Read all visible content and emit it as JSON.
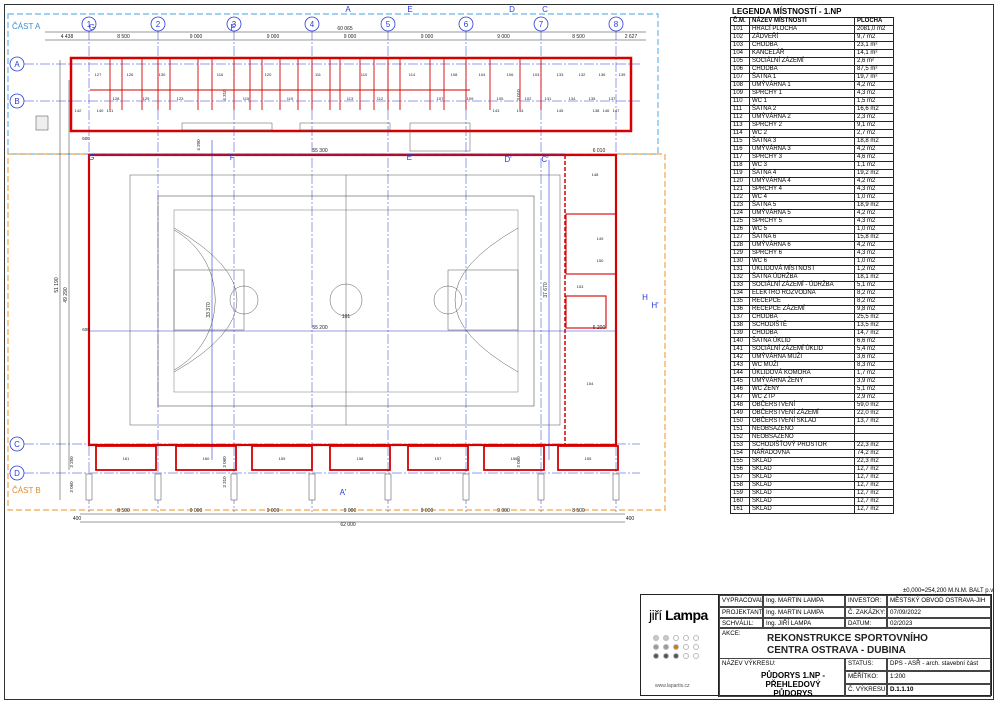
{
  "legend": {
    "title": "LEGENDA MÍSTNOSTÍ - 1.NP",
    "headers": [
      "Č.M.",
      "NÁZEV MÍSTNOSTI",
      "PLOCHA"
    ],
    "rows": [
      [
        "101",
        "HRACÍ PLOCHA",
        "2081,0 m2"
      ],
      [
        "102",
        "ZÁDVEŘÍ",
        "9,7 m2"
      ],
      [
        "103",
        "CHODBA",
        "23,1 m²"
      ],
      [
        "104",
        "KANCELÁŘ",
        "14,1 m²"
      ],
      [
        "105",
        "SOCIÁLNÍ ZÁZEMÍ",
        "2,6 m²"
      ],
      [
        "106",
        "CHODBA",
        "87,5 m²"
      ],
      [
        "107",
        "ŠATNA 1",
        "19,7 m²"
      ],
      [
        "108",
        "UMÝVÁRNA 1",
        "4,2 m2"
      ],
      [
        "109",
        "SPRCHY 1",
        "4,3 m2"
      ],
      [
        "110",
        "WC 1",
        "1,5 m2"
      ],
      [
        "111",
        "ŠATNA 2",
        "16,6 m2"
      ],
      [
        "112",
        "UMÝVÁRNA 2",
        "2,3 m2"
      ],
      [
        "113",
        "SPRCHY 2",
        "9,1 m2"
      ],
      [
        "114",
        "WC 2",
        "2,7 m2"
      ],
      [
        "115",
        "ŠATNA 3",
        "18,8 m2"
      ],
      [
        "116",
        "UMÝVÁRNA 3",
        "4,2 m2"
      ],
      [
        "117",
        "SPRCHY 3",
        "4,6 m2"
      ],
      [
        "118",
        "WC 3",
        "1,1 m2"
      ],
      [
        "119",
        "ŠATNA 4",
        "19,2 m2"
      ],
      [
        "120",
        "UMÝVÁRNA 4",
        "4,2 m2"
      ],
      [
        "121",
        "SPRCHY 4",
        "4,3 m2"
      ],
      [
        "122",
        "WC 4",
        "1,0 m2"
      ],
      [
        "123",
        "ŠATNA 5",
        "18,9 m2"
      ],
      [
        "124",
        "UMÝVÁRNA 5",
        "4,2 m2"
      ],
      [
        "125",
        "SPRCHY 5",
        "4,3 m2"
      ],
      [
        "126",
        "WC 5",
        "1,0 m2"
      ],
      [
        "127",
        "ŠATNA 6",
        "15,8 m2"
      ],
      [
        "128",
        "UMÝVÁRNA 6",
        "4,2 m2"
      ],
      [
        "129",
        "SPRCHY 6",
        "4,3 m2"
      ],
      [
        "130",
        "WC 6",
        "1,0 m2"
      ],
      [
        "131",
        "ÚKLIDOVÁ MÍSTNOST",
        "1,2 m2"
      ],
      [
        "132",
        "ŠATNA ÚDRŽBA",
        "18,1 m2"
      ],
      [
        "133",
        "SOCIÁLNÍ ZÁZEMÍ - ÚDRŽBA",
        "5,1 m2"
      ],
      [
        "134",
        "ELEKTRO ROZVODNA",
        "8,2 m2"
      ],
      [
        "135",
        "RECEPCE",
        "8,2 m2"
      ],
      [
        "136",
        "RECEPCE ZÁZEMÍ",
        "9,8 m2"
      ],
      [
        "137",
        "CHODBA",
        "25,5 m2"
      ],
      [
        "138",
        "SCHODIŠTĚ",
        "13,5 m2"
      ],
      [
        "139",
        "CHODBA",
        "14,7 m2"
      ],
      [
        "140",
        "ŠATNA ÚKLID",
        "6,6 m2"
      ],
      [
        "141",
        "SOCIÁLNÍ ZÁZEMÍ ÚKLID",
        "5,4 m2"
      ],
      [
        "142",
        "UMÝVÁRNA MUŽI",
        "3,6 m2"
      ],
      [
        "143",
        "WC MUŽI",
        "8,3 m2"
      ],
      [
        "144",
        "ÚKLIDOVÁ KOMORA",
        "1,7 m2"
      ],
      [
        "145",
        "UMÝVÁRNA ŽENY",
        "3,9 m2"
      ],
      [
        "146",
        "WC ŽENY",
        "5,1 m2"
      ],
      [
        "147",
        "WC ZTP",
        "2,9 m2"
      ],
      [
        "148",
        "OBČERSTVENÍ",
        "59,0 m2"
      ],
      [
        "149",
        "OBČERSTVENÍ ZÁZEMÍ",
        "22,0 m2"
      ],
      [
        "150",
        "OBČERSTVENÍ SKLAD",
        "13,7 m2"
      ],
      [
        "151",
        "NEOBSAZENO",
        ""
      ],
      [
        "152",
        "NEOBSAZENO",
        ""
      ],
      [
        "153",
        "SCHODIŠŤOVÝ PROSTOR",
        "22,3 m2"
      ],
      [
        "154",
        "NÁŘADOVNA",
        "74,2 m2"
      ],
      [
        "155",
        "SKLAD",
        "22,3 m2"
      ],
      [
        "156",
        "SKLAD",
        "12,7 m2"
      ],
      [
        "157",
        "SKLAD",
        "12,7 m2"
      ],
      [
        "158",
        "SKLAD",
        "12,7 m2"
      ],
      [
        "159",
        "SKLAD",
        "12,7 m2"
      ],
      [
        "160",
        "SKLAD",
        "12,7 m2"
      ],
      [
        "161",
        "SKLAD",
        "12,7 m2"
      ]
    ]
  },
  "plan": {
    "zone_a": "ČÁST A",
    "zone_b": "ČÁST B",
    "col_axes": [
      "1",
      "2",
      "3",
      "4",
      "5",
      "6",
      "7",
      "8"
    ],
    "row_axes": [
      "A",
      "B",
      "C",
      "D"
    ],
    "top_dims": [
      "4 438",
      "8 500",
      "9 000",
      "9 000",
      "9 000",
      "9 000",
      "9 000",
      "8 500",
      "2 627"
    ],
    "top_total": "60 065",
    "bottom_dims": [
      "8 500",
      "9 000",
      "9 000",
      "9 000",
      "9 000",
      "9 000",
      "8 500"
    ],
    "bottom_total": "62 000",
    "bottom_left": "400",
    "bottom_right": "400",
    "left_dims": [
      "51 190",
      "49 290"
    ],
    "mid_dims": [
      "55 300",
      "6 010",
      "55 200",
      "6 200",
      "33 370",
      "37 670"
    ],
    "small_dims": [
      "600",
      "600",
      "4 200",
      "3 250",
      "3 060",
      "3 310",
      "3 060",
      "4 310",
      "3 060",
      "3 010"
    ],
    "section_marks": [
      "A",
      "A'",
      "D",
      "D'",
      "E",
      "E'",
      "F",
      "F'",
      "G",
      "G'",
      "C",
      "C'",
      "H",
      "H'"
    ],
    "court_label": "101",
    "upper_rooms": [
      "127",
      "128",
      "126",
      "129",
      "130",
      "123",
      "116",
      "115",
      "120",
      "119",
      "111",
      "113",
      "110",
      "112",
      "114",
      "107",
      "108",
      "109",
      "104",
      "105",
      "106",
      "102",
      "103",
      "131",
      "133",
      "134",
      "132",
      "135",
      "136",
      "137",
      "139",
      "140",
      "141",
      "142",
      "143",
      "144",
      "145",
      "146",
      "147",
      "138"
    ],
    "right_rooms": [
      "148",
      "149",
      "150",
      "153",
      "154"
    ],
    "bottom_rooms": [
      "161",
      "160",
      "159",
      "158",
      "157",
      "156",
      "155"
    ]
  },
  "title_block": {
    "elevation": "±0,000=254,200 M.N.M. BALT p.v.",
    "logo_text_light": "jiří",
    "logo_text_bold": "Lampa",
    "logo_url": "www.lapartis.cz",
    "labels": {
      "drawn_by": "VYPRACOVAL:",
      "designer": "PROJEKTANT:",
      "approved": "SCHVÁLIL:",
      "investor": "INVESTOR:",
      "order_no": "Č. ZAKÁZKY:",
      "date": "DATUM:",
      "action": "AKCE:",
      "drawing_name": "NÁZEV VÝKRESU:",
      "status": "STATUS:",
      "scale": "MĚŘÍTKO:",
      "drawing_no": "Č. VÝKRESU:"
    },
    "values": {
      "drawn_by": "Ing. MARTIN LAMPA",
      "designer": "Ing. MARTIN LAMPA",
      "approved": "Ing. JIŘÍ LAMPA",
      "investor": "MĚSTSKÝ OBVOD OSTRAVA-JIH",
      "order_no": "07/09/2022",
      "date": "02/2023",
      "project": "REKONSTRUKCE SPORTOVNÍHO CENTRA OSTRAVA - DUBINA",
      "drawing_name": "PŮDORYS 1.NP - PŘEHLEDOVÝ PŮDORYS",
      "status": "DPS - ASŘ - arch. stavební část",
      "scale": "1:200",
      "drawing_no": "D.1.1.10"
    },
    "dot_colors": [
      "#c9c9c9",
      "#c9c9c9",
      "#ffffff",
      "#ffffff",
      "#ffffff",
      "#9a9a9a",
      "#9a9a9a",
      "#c97a1e",
      "#ffffff",
      "#ffffff",
      "#555555",
      "#555555",
      "#555555",
      "#ffffff",
      "#ffffff"
    ]
  },
  "colors": {
    "wall_red": "#d60000",
    "axis": "#2a3bd6",
    "zone_a": "#6ab7e8",
    "zone_b": "#f0a64a",
    "court": "#555555"
  }
}
